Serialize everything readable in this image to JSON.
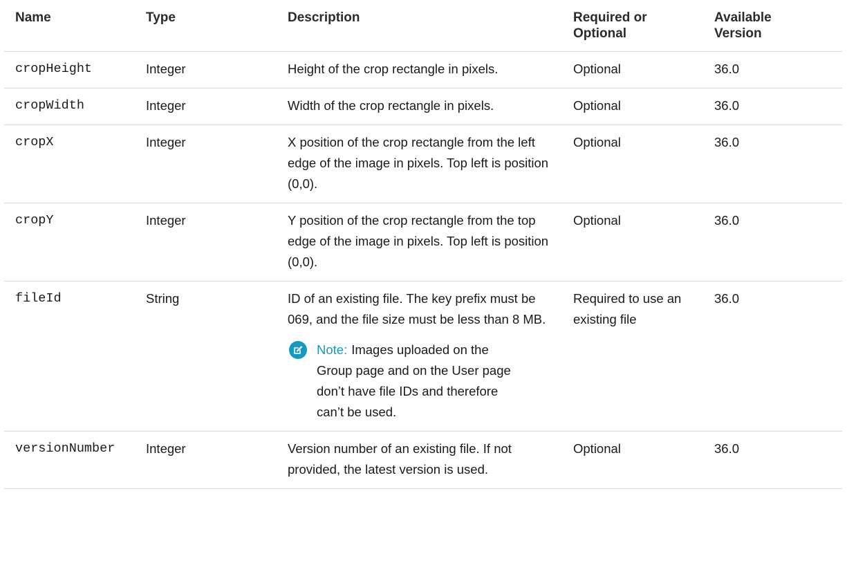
{
  "table": {
    "headers": {
      "name": "Name",
      "type": "Type",
      "description": "Description",
      "required": "Required or Optional",
      "version": "Available Version"
    },
    "rows": [
      {
        "name": "cropHeight",
        "type": "Integer",
        "description": "Height of the crop rectangle in pixels.",
        "required": "Optional",
        "version": "36.0"
      },
      {
        "name": "cropWidth",
        "type": "Integer",
        "description": "Width of the crop rectangle in pixels.",
        "required": "Optional",
        "version": "36.0"
      },
      {
        "name": "cropX",
        "type": "Integer",
        "description": "X position of the crop rectangle from the left edge of the image in pixels. Top left is position (0,0).",
        "required": "Optional",
        "version": "36.0"
      },
      {
        "name": "cropY",
        "type": "Integer",
        "description": "Y position of the crop rectangle from the top edge of the image in pixels. Top left is position (0,0).",
        "required": "Optional",
        "version": "36.0"
      },
      {
        "name": "fileId",
        "type": "String",
        "description": "ID of an existing file. The key prefix must be 069, and the file size must be less than 8 MB.",
        "required": "Required to use an existing file",
        "version": "36.0",
        "note": {
          "label": "Note:",
          "text": "Images uploaded on the Group page and on the User page don’t have file IDs and therefore can’t be used.",
          "icon": "edit-note-icon",
          "color": "#1798c1"
        }
      },
      {
        "name": "versionNumber",
        "type": "Integer",
        "description": "Version number of an existing file. If not provided, the latest version is used.",
        "required": "Optional",
        "version": "36.0"
      }
    ]
  }
}
